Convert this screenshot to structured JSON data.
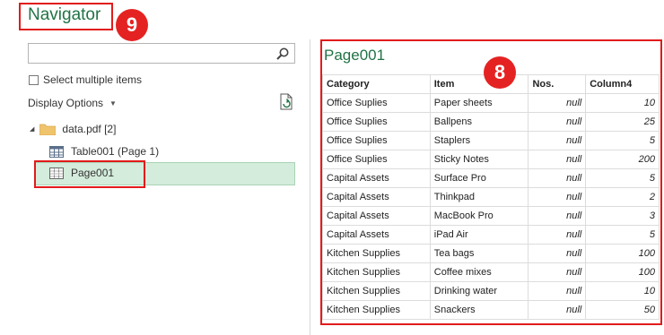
{
  "window": {
    "title": "Navigator"
  },
  "annotations": {
    "title_badge": "9",
    "preview_badge": "8"
  },
  "search": {
    "placeholder": ""
  },
  "options": {
    "select_multiple": "Select multiple items",
    "display_options": "Display Options"
  },
  "tree": {
    "folder": "data.pdf [2]",
    "items": [
      {
        "label": "Table001 (Page 1)"
      },
      {
        "label": "Page001",
        "selected": true
      }
    ]
  },
  "preview": {
    "title": "Page001",
    "columns": [
      "Category",
      "Item",
      "Nos.",
      "Column4"
    ],
    "rows": [
      [
        "Office Suplies",
        "Paper sheets",
        "null",
        "10"
      ],
      [
        "Office Suplies",
        "Ballpens",
        "null",
        "25"
      ],
      [
        "Office Suplies",
        "Staplers",
        "null",
        "5"
      ],
      [
        "Office Suplies",
        "Sticky Notes",
        "null",
        "200"
      ],
      [
        "Capital Assets",
        "Surface Pro",
        "null",
        "5"
      ],
      [
        "Capital Assets",
        "Thinkpad",
        "null",
        "2"
      ],
      [
        "Capital Assets",
        "MacBook Pro",
        "null",
        "3"
      ],
      [
        "Capital Assets",
        "iPad Air",
        "null",
        "5"
      ],
      [
        "Kitchen Supplies",
        "Tea bags",
        "null",
        "100"
      ],
      [
        "Kitchen Supplies",
        "Coffee mixes",
        "null",
        "100"
      ],
      [
        "Kitchen Supplies",
        "Drinking water",
        "null",
        "10"
      ],
      [
        "Kitchen Supplies",
        "Snackers",
        "null",
        "50"
      ]
    ]
  },
  "colors": {
    "accent_green": "#217346",
    "selection": "#d4ecdb",
    "annotation_red": "#e21b1b"
  }
}
